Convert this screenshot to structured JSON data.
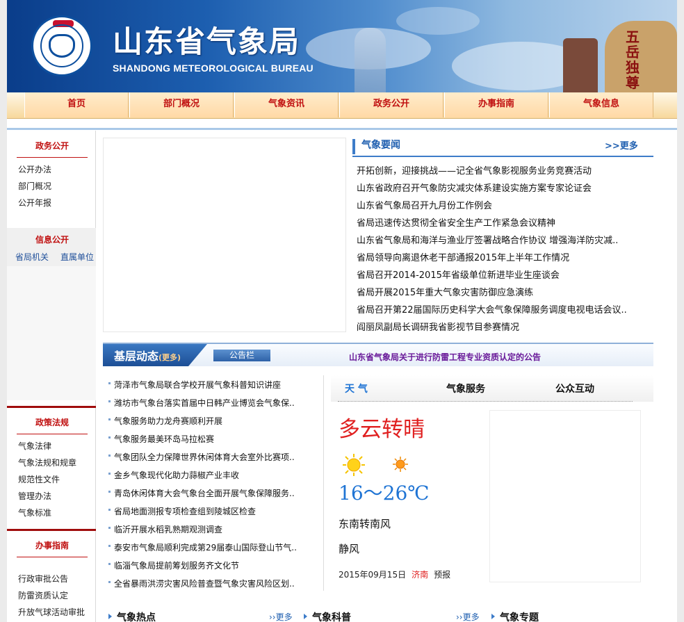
{
  "header": {
    "title": "山东省气象局",
    "subtitle": "SHANDONG METEOROLOGICAL BUREAU",
    "rock_text": "五岳独尊"
  },
  "nav": {
    "items": [
      "首页",
      "部门概况",
      "气象资讯",
      "政务公开",
      "办事指南",
      "气象信息"
    ]
  },
  "sidebar": {
    "gov_open": {
      "heading": "政务公开",
      "links": [
        "公开办法",
        "部门概况",
        "公开年报"
      ]
    },
    "info_open": {
      "heading": "信息公开",
      "links": [
        "省局机关",
        "直属单位"
      ]
    },
    "policy": {
      "heading": "政策法规",
      "links": [
        "气象法律",
        "气象法规和规章",
        "规范性文件",
        "管理办法",
        "气象标准"
      ]
    },
    "guide": {
      "heading": "办事指南",
      "links": [
        "行政审批公告",
        "防雷资质认定",
        "升放气球活动审批"
      ]
    }
  },
  "news": {
    "tab": "气象要闻",
    "more": ">>更多",
    "items": [
      "开拓创新，迎接挑战——记全省气象影视服务业务竞赛活动",
      "山东省政府召开气象防灾减灾体系建设实施方案专家论证会",
      "山东省气象局召开九月份工作例会",
      "省局迅速传达贯彻全省安全生产工作紧急会议精神",
      "山东省气象局和海洋与渔业厅签署战略合作协议  增强海洋防灾减..",
      "省局领导向离退休老干部通报2015年上半年工作情况",
      "省局召开2014-2015年省级单位新进毕业生座谈会",
      "省局开展2015年重大气象灾害防御应急演练",
      "省局召开第22届国际历史科学大会气象保障服务调度电视电话会议..",
      "阎丽凤副局长调研我省影视节目参赛情况"
    ]
  },
  "grassroots": {
    "title": "基层动态",
    "title_more": "(更多)",
    "notice_tab": "公告栏",
    "notice_text": "山东省气象局关于进行防雷工程专业资质认定的公告",
    "items": [
      "菏泽市气象局联合学校开展气象科普知识讲座",
      "潍坊市气象台落实首届中日韩产业博览会气象保..",
      "气象服务助力龙舟赛顺利开展",
      "气象服务最美环岛马拉松赛",
      "气象团队全力保障世界休闲体育大会室外比赛项..",
      "金乡气象现代化助力蒜椒产业丰收",
      "青岛休闲体育大会气象台全面开展气象保障服务..",
      "省局地面测报专项检查组到陵城区检查",
      "临沂开展水稻乳熟期观测调查",
      "泰安市气象局顺利完成第29届泰山国际登山节气..",
      "临淄气象局提前筹划服务齐文化节",
      "全省暴雨洪涝灾害风险普查暨气象灾害风险区划.."
    ]
  },
  "weather": {
    "tabs": [
      "天 气",
      "气象服务",
      "公众互动"
    ],
    "condition": "多云转晴",
    "temperature": "16～26℃",
    "wind": "东南转南风",
    "force": "静风",
    "date": "2015年09月15日",
    "city": "济南",
    "forecast_label": "预报",
    "icons": [
      "sun-icon",
      "sun-small-icon"
    ]
  },
  "bottom": {
    "hot": "气象热点",
    "science": "气象科普",
    "special": "气象专题",
    "more": "››更多"
  }
}
